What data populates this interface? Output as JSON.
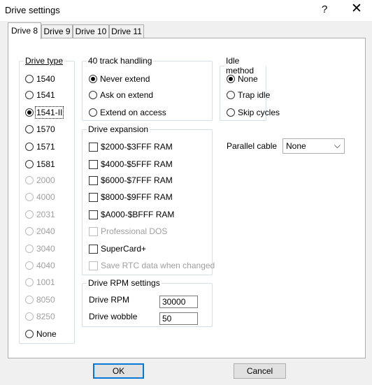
{
  "window": {
    "title": "Drive settings",
    "help_label": "?",
    "close_label": "✕"
  },
  "tabs": [
    {
      "label": "Drive 8",
      "active": true
    },
    {
      "label": "Drive 9",
      "active": false
    },
    {
      "label": "Drive 10",
      "active": false
    },
    {
      "label": "Drive 11",
      "active": false
    }
  ],
  "drive_type": {
    "legend": "Drive type",
    "options": [
      {
        "label": "1540",
        "checked": false,
        "enabled": true
      },
      {
        "label": "1541",
        "checked": false,
        "enabled": true
      },
      {
        "label": "1541-II",
        "checked": true,
        "enabled": true
      },
      {
        "label": "1570",
        "checked": false,
        "enabled": true
      },
      {
        "label": "1571",
        "checked": false,
        "enabled": true
      },
      {
        "label": "1581",
        "checked": false,
        "enabled": true
      },
      {
        "label": "2000",
        "checked": false,
        "enabled": false
      },
      {
        "label": "4000",
        "checked": false,
        "enabled": false
      },
      {
        "label": "2031",
        "checked": false,
        "enabled": false
      },
      {
        "label": "2040",
        "checked": false,
        "enabled": false
      },
      {
        "label": "3040",
        "checked": false,
        "enabled": false
      },
      {
        "label": "4040",
        "checked": false,
        "enabled": false
      },
      {
        "label": "1001",
        "checked": false,
        "enabled": false
      },
      {
        "label": "8050",
        "checked": false,
        "enabled": false
      },
      {
        "label": "8250",
        "checked": false,
        "enabled": false
      },
      {
        "label": "None",
        "checked": false,
        "enabled": true
      }
    ]
  },
  "track_handling": {
    "legend": "40 track handling",
    "options": [
      {
        "label": "Never extend",
        "checked": true
      },
      {
        "label": "Ask on extend",
        "checked": false
      },
      {
        "label": "Extend on access",
        "checked": false
      }
    ]
  },
  "drive_expansion": {
    "legend": "Drive expansion",
    "options": [
      {
        "label": "$2000-$3FFF RAM",
        "checked": false,
        "enabled": true
      },
      {
        "label": "$4000-$5FFF RAM",
        "checked": false,
        "enabled": true
      },
      {
        "label": "$6000-$7FFF RAM",
        "checked": false,
        "enabled": true
      },
      {
        "label": "$8000-$9FFF RAM",
        "checked": false,
        "enabled": true
      },
      {
        "label": "$A000-$BFFF RAM",
        "checked": false,
        "enabled": true
      },
      {
        "label": "Professional DOS",
        "checked": false,
        "enabled": false
      },
      {
        "label": "SuperCard+",
        "checked": false,
        "enabled": true
      },
      {
        "label": "Save RTC data when changed",
        "checked": false,
        "enabled": false
      }
    ]
  },
  "rpm": {
    "legend": "Drive RPM settings",
    "rpm_label": "Drive RPM",
    "rpm_value": "30000",
    "wobble_label": "Drive wobble",
    "wobble_value": "50"
  },
  "idle": {
    "legend": "Idle method",
    "options": [
      {
        "label": "None",
        "checked": true
      },
      {
        "label": "Trap idle",
        "checked": false
      },
      {
        "label": "Skip cycles",
        "checked": false
      }
    ]
  },
  "parallel": {
    "label": "Parallel cable",
    "value": "None"
  },
  "buttons": {
    "ok": "OK",
    "cancel": "Cancel"
  }
}
